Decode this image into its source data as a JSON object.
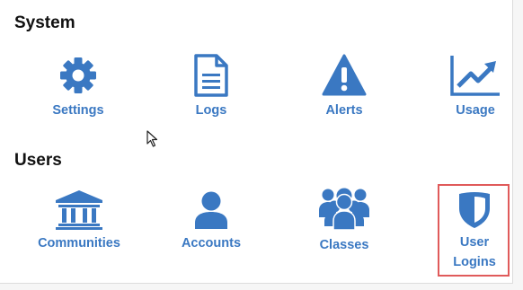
{
  "system": {
    "title": "System",
    "items": [
      {
        "label": "Settings",
        "icon": "gear-icon"
      },
      {
        "label": "Logs",
        "icon": "document-icon"
      },
      {
        "label": "Alerts",
        "icon": "warning-icon"
      },
      {
        "label": "Usage",
        "icon": "trend-chart-icon"
      }
    ]
  },
  "users": {
    "title": "Users",
    "items": [
      {
        "label": "Communities",
        "icon": "institution-icon"
      },
      {
        "label": "Accounts",
        "icon": "user-icon"
      },
      {
        "label": "Classes",
        "icon": "group-icon"
      },
      {
        "label": "User\nLogins",
        "icon": "shield-icon",
        "highlighted": true
      }
    ]
  },
  "colors": {
    "accent": "#3a78c2",
    "highlight_border": "#e05a5a",
    "text": "#111111"
  }
}
